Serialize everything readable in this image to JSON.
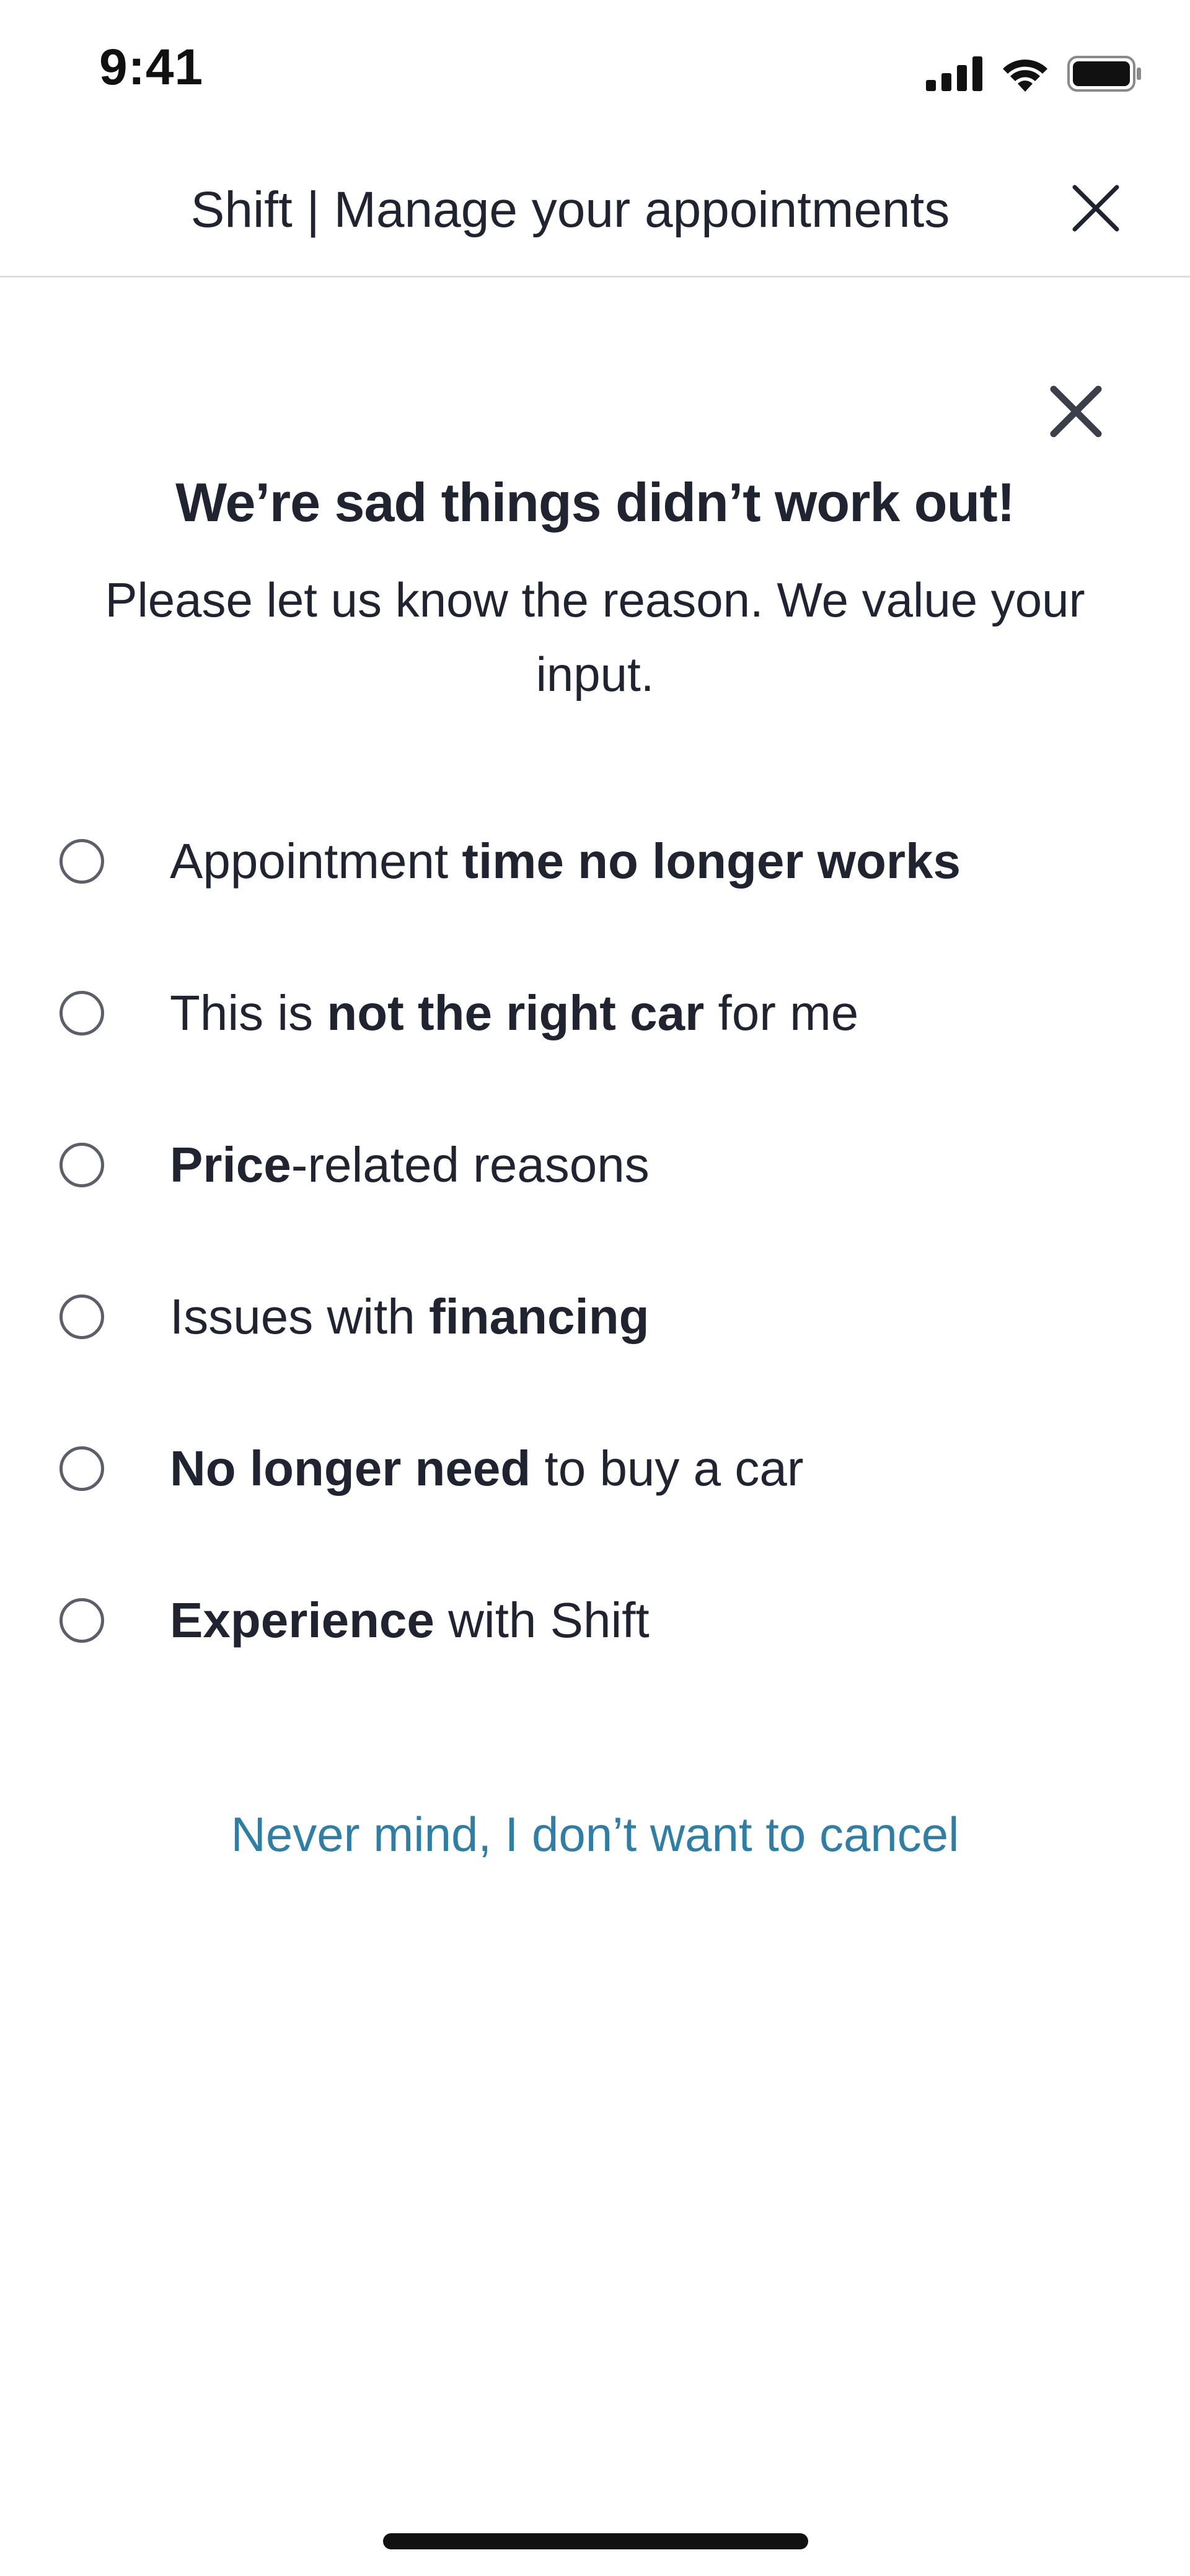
{
  "status_bar": {
    "time": "9:41",
    "icons": [
      "signal-icon",
      "wifi-icon",
      "battery-icon"
    ]
  },
  "header": {
    "title": "Shift | Manage your appointments",
    "close_icon": "close-icon"
  },
  "modal": {
    "close_icon": "close-icon",
    "title": "We’re sad things didn’t work out!",
    "subtitle": "Please let us know the reason. We value your input.",
    "reasons": [
      {
        "prefix": "Appointment ",
        "bold": "time no longer works",
        "suffix": ""
      },
      {
        "prefix": "This is ",
        "bold": "not the right car",
        "suffix": " for me"
      },
      {
        "prefix": "",
        "bold": "Price",
        "suffix": "-related reasons"
      },
      {
        "prefix": "Issues with ",
        "bold": "financing",
        "suffix": ""
      },
      {
        "prefix": "",
        "bold": "No longer need",
        "suffix": " to buy a car"
      },
      {
        "prefix": "",
        "bold": "Experience",
        "suffix": " with Shift"
      }
    ],
    "cancel_link": "Never mind, I don’t want to cancel"
  },
  "colors": {
    "text": "#1f2430",
    "link": "#2f7ea6",
    "divider": "#dcdee2",
    "radio_border": "#5a5f69"
  }
}
